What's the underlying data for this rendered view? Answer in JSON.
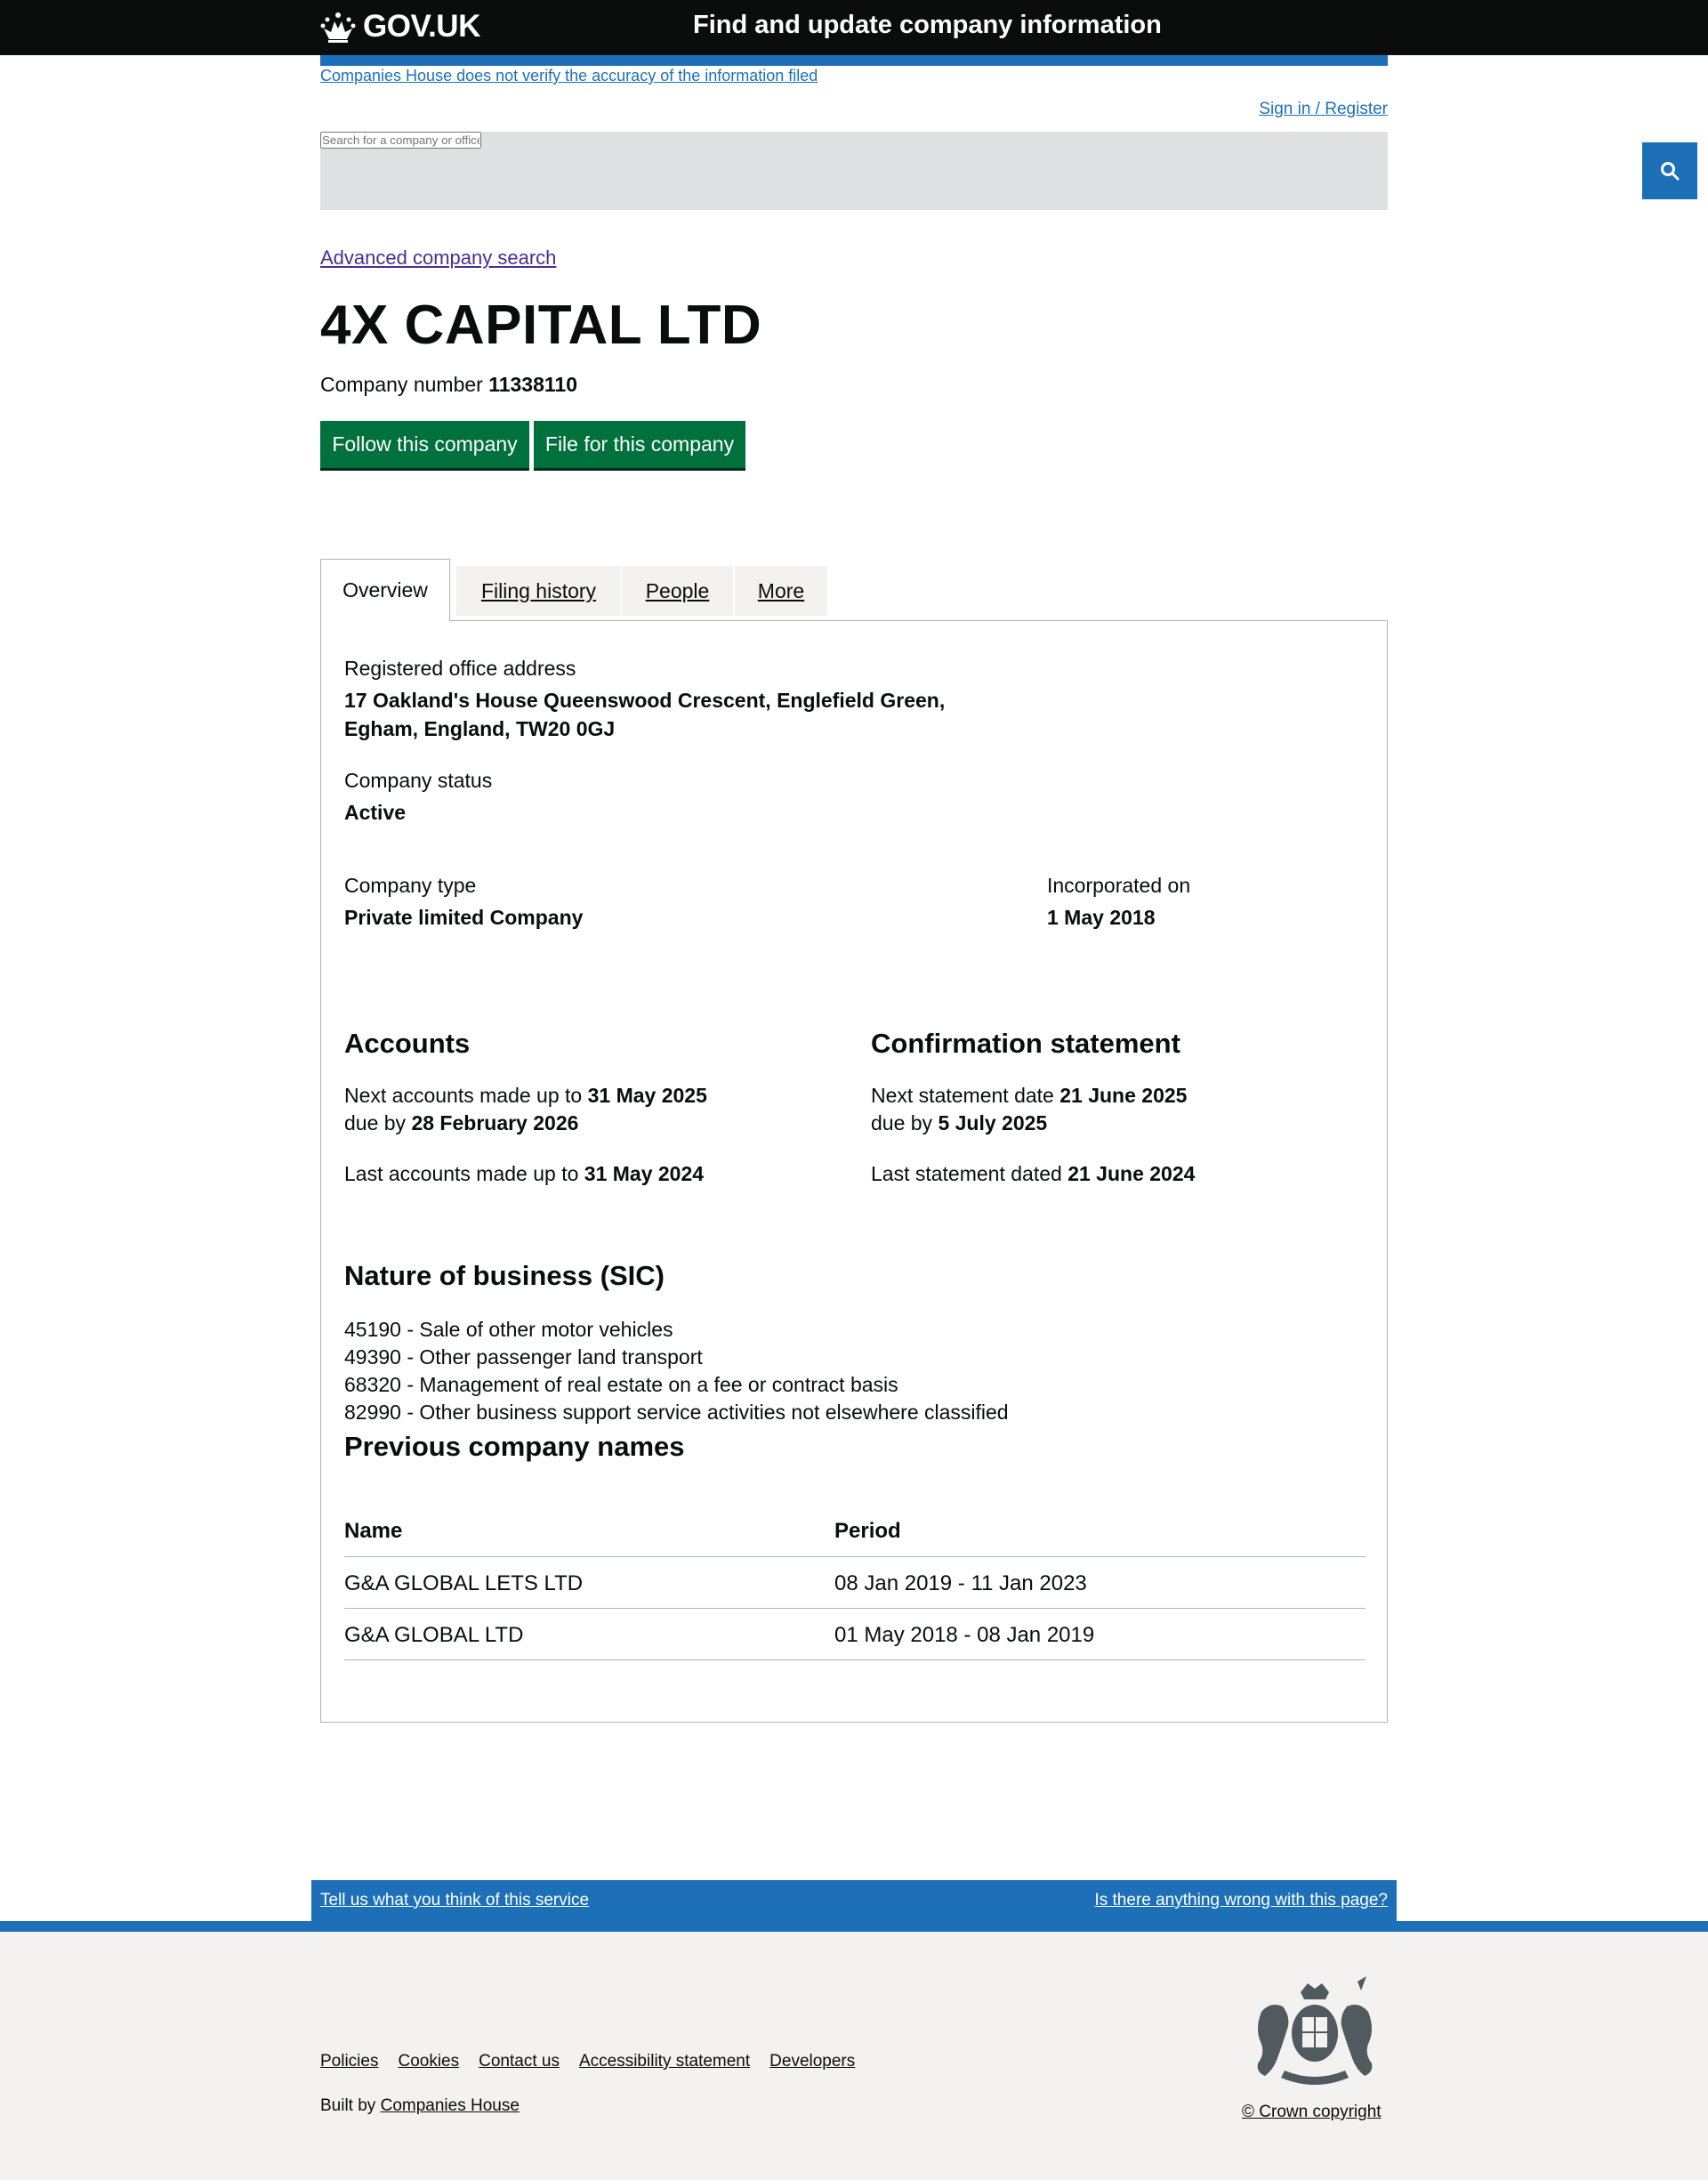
{
  "header": {
    "logo_text": "GOV.UK",
    "service_name": "Find and update company information"
  },
  "disclaimer": "Companies House does not verify the accuracy of the information filed",
  "signin": "Sign in / Register",
  "search": {
    "placeholder": "Search for a company or officer",
    "button_icon": "search-icon"
  },
  "advanced_search": "Advanced company search",
  "company": {
    "name": "4X CAPITAL LTD",
    "number_label": "Company number",
    "number": "11338110"
  },
  "buttons": {
    "follow": "Follow this company",
    "file": "File for this company"
  },
  "tabs": [
    {
      "label": "Overview",
      "active": true
    },
    {
      "label": "Filing history",
      "active": false
    },
    {
      "label": "People",
      "active": false
    },
    {
      "label": "More",
      "active": false
    }
  ],
  "overview": {
    "address_label": "Registered office address",
    "address_line1": "17 Oakland's House Queenswood Crescent, Englefield Green,",
    "address_line2": "Egham, England, TW20 0GJ",
    "status_label": "Company status",
    "status": "Active",
    "type_label": "Company type",
    "type": "Private limited Company",
    "incorporated_label": "Incorporated on",
    "incorporated": "1 May 2018"
  },
  "accounts": {
    "heading": "Accounts",
    "next_prefix": "Next accounts made up to",
    "next_date": "31 May 2025",
    "due_prefix": "due by",
    "due_date": "28 February 2026",
    "last_prefix": "Last accounts made up to",
    "last_date": "31 May 2024"
  },
  "confirmation": {
    "heading": "Confirmation statement",
    "next_prefix": "Next statement date",
    "next_date": "21 June 2025",
    "due_prefix": "due by",
    "due_date": "5 July 2025",
    "last_prefix": "Last statement dated",
    "last_date": "21 June 2024"
  },
  "sic": {
    "heading": "Nature of business (SIC)",
    "items": [
      "45190 - Sale of other motor vehicles",
      "49390 - Other passenger land transport",
      "68320 - Management of real estate on a fee or contract basis",
      "82990 - Other business support service activities not elsewhere classified"
    ]
  },
  "previous_names": {
    "heading": "Previous company names",
    "columns": [
      "Name",
      "Period"
    ],
    "rows": [
      {
        "name": "G&A GLOBAL LETS LTD",
        "period": "08 Jan 2019 - 11 Jan 2023"
      },
      {
        "name": "G&A GLOBAL LTD",
        "period": "01 May 2018 - 08 Jan 2019"
      }
    ]
  },
  "feedback": {
    "left": "Tell us what you think of this service",
    "right": "Is there anything wrong with this page?"
  },
  "footer": {
    "links": [
      "Policies",
      "Cookies",
      "Contact us",
      "Accessibility statement",
      "Developers"
    ],
    "built_by_prefix": "Built by",
    "built_by_link": "Companies House",
    "copyright": "© Crown copyright",
    "crest_icon": "royal-coat-of-arms-icon"
  }
}
